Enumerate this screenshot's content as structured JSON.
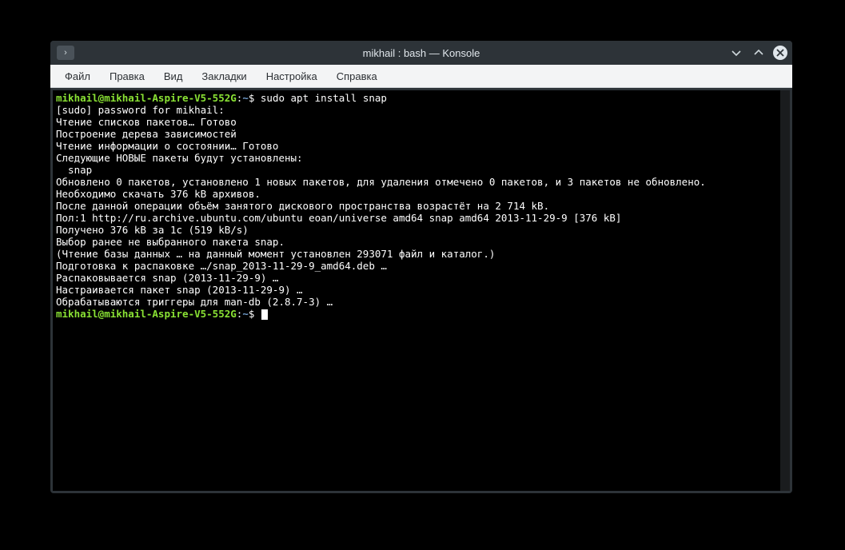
{
  "titlebar": {
    "badge": "›",
    "title": "mikhail : bash — Konsole"
  },
  "menubar": {
    "items": [
      "Файл",
      "Правка",
      "Вид",
      "Закладки",
      "Настройка",
      "Справка"
    ]
  },
  "terminal": {
    "prompt_user": "mikhail@mikhail-Aspire-V5-552G",
    "prompt_sep": ":",
    "prompt_path": "~",
    "prompt_end": "$ ",
    "command1": "sudo apt install snap",
    "lines": [
      "[sudo] password for mikhail: ",
      "Чтение списков пакетов… Готово",
      "Построение дерева зависимостей       ",
      "Чтение информации о состоянии… Готово",
      "Следующие НОВЫЕ пакеты будут установлены:",
      "  snap",
      "Обновлено 0 пакетов, установлено 1 новых пакетов, для удаления отмечено 0 пакетов, и 3 пакетов не обновлено.",
      "Необходимо скачать 376 kB архивов.",
      "После данной операции объём занятого дискового пространства возрастёт на 2 714 kB.",
      "Пол:1 http://ru.archive.ubuntu.com/ubuntu eoan/universe amd64 snap amd64 2013-11-29-9 [376 kB]",
      "Получено 376 kB за 1с (519 kB/s)",
      "Выбор ранее не выбранного пакета snap.",
      "(Чтение базы данных … на данный момент установлен 293071 файл и каталог.)",
      "Подготовка к распаковке …/snap_2013-11-29-9_amd64.deb …",
      "Распаковывается snap (2013-11-29-9) …",
      "Настраивается пакет snap (2013-11-29-9) …",
      "Обрабатываются триггеры для man-db (2.8.7-3) …"
    ]
  }
}
